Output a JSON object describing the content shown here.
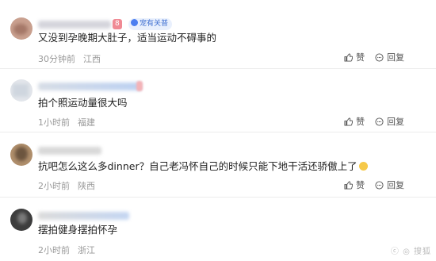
{
  "comments": [
    {
      "level": "8",
      "badge": "宠有关普",
      "text": "又没到孕晚期大肚子，适当运动不碍事的",
      "time": "30分钟前",
      "location": "江西",
      "like_label": "赞",
      "reply_label": "回复"
    },
    {
      "text": "拍个照运动量很大吗",
      "time": "1小时前",
      "location": "福建",
      "like_label": "赞",
      "reply_label": "回复"
    },
    {
      "text": "抗吧怎么这么多dinner？自己老冯怀自己的时候只能下地干活还骄傲上了",
      "time": "2小时前",
      "location": "陕西",
      "like_label": "赞",
      "reply_label": "回复"
    },
    {
      "text": "摆拍健身摆拍怀孕",
      "time": "2小时前",
      "location": "浙江",
      "like_label": "赞",
      "reply_label": "回复"
    }
  ],
  "watermark": "ⓒ ◎ 搜狐",
  "colors": {
    "text": "#222222",
    "meta": "#999999",
    "level_badge": "#f08a94",
    "badge_text": "#3f6fd1",
    "badge_bg": "#e9f0fd"
  }
}
